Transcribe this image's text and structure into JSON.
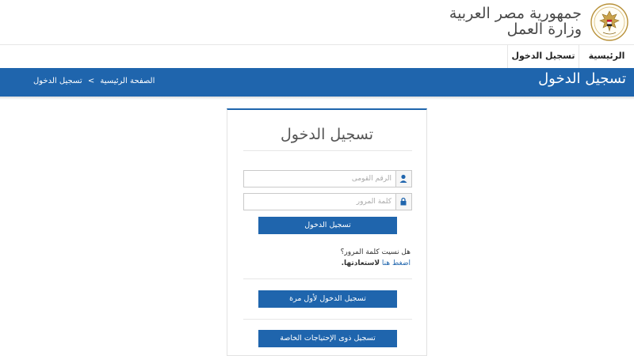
{
  "header": {
    "line1": "جمهورية مصر العربية",
    "line2": "وزارة العمل",
    "emblem_icon": "egypt-eagle-emblem-icon"
  },
  "nav": {
    "items": [
      {
        "label": "الرئيسية"
      },
      {
        "label": "تسجيل الدخول"
      }
    ]
  },
  "bar": {
    "page_title": "تسجيل الدخول",
    "breadcrumb": {
      "home": "الصفحة الرئيسية",
      "separator": ">",
      "current": "تسجيل الدخول"
    }
  },
  "login": {
    "title": "تسجيل الدخول",
    "national_id_placeholder": "الرقم القومى",
    "password_placeholder": "كلمة المرور",
    "login_button": "تسجيل الدخول",
    "forgot_question": "هل نسيت كلمة المرور؟",
    "forgot_link": "اضغط هنا",
    "forgot_suffix": "لاستعادتها.",
    "first_time_button": "تسجيل الدخول لأول مرة",
    "special_needs_button": "تسجيل ذوى الإحتياجات الخاصة"
  },
  "colors": {
    "primary": "#1f65ad",
    "text": "#4a4a4a"
  }
}
